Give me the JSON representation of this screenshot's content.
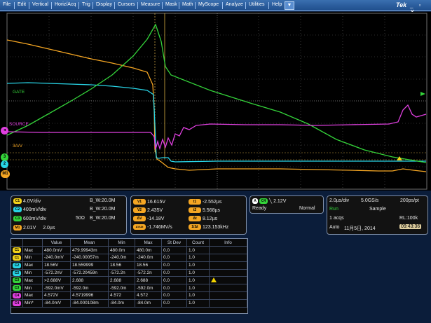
{
  "menu": {
    "items": [
      "File",
      "Edit",
      "Vertical",
      "Horiz/Acq",
      "Trig",
      "Display",
      "Cursors",
      "Measure",
      "Mask",
      "Math",
      "MyScope",
      "Analyze",
      "Utilities",
      "Help"
    ],
    "dropdown_glyph": "▼",
    "brand": "Tek",
    "window_buttons": "_ ▫ ✕"
  },
  "screen": {
    "labels": {
      "gate": "GATE",
      "source": "SOURCE",
      "threshold": "3A/V"
    },
    "markers": {
      "ch1": "1",
      "ch2": "2",
      "ch3": "3",
      "math": "M1"
    },
    "colors": {
      "ch1": "#f2d21a",
      "ch2": "#28d4e6",
      "ch3": "#34d33a",
      "ch4": "#e040e0",
      "math": "#f5a623"
    }
  },
  "channels": [
    {
      "tag": "C1",
      "color": "#f2d21a",
      "scale": "4.0V/div",
      "extra": "",
      "bw": "B_W:20.0M"
    },
    {
      "tag": "C2",
      "color": "#28d4e6",
      "scale": "400mV/div",
      "extra": "",
      "bw": "B_W:20.0M"
    },
    {
      "tag": "C3",
      "color": "#34d33a",
      "scale": "600mV/div",
      "extra": "50Ω",
      "bw": "B_W:20.0M"
    },
    {
      "tag": "M1",
      "color": "#f5a623",
      "scale": "2.01V",
      "extra": "2.0µs",
      "bw": ""
    }
  ],
  "cursors": {
    "v1": {
      "label": "V1",
      "value": "16.615V"
    },
    "t1": {
      "label": "t1",
      "value": "-2.552µs"
    },
    "v2": {
      "label": "V2",
      "value": "2.435V"
    },
    "t2": {
      "label": "t2",
      "value": "5.568µs"
    },
    "dv": {
      "label": "ΔV",
      "value": "-14.18V"
    },
    "dt": {
      "label": "Δt",
      "value": "8.12µs"
    },
    "dvdt": {
      "label": "ΔV/Δt",
      "value": "-1.746MV/s"
    },
    "freq": {
      "label": "1/Δt",
      "value": "123.153kHz"
    }
  },
  "trigger": {
    "source": "A",
    "channel": "C4",
    "level": "2.12V",
    "state": "Ready",
    "mode": "Normal"
  },
  "acquisition": {
    "timebase": "2.0µs/div",
    "rate": "5.0GS/s",
    "resolution": "200ps/pt",
    "run_state": "Run",
    "mode": "Sample",
    "acqs": "1 acqs",
    "record_length": "RL:100k",
    "auto": "Auto",
    "date": "11月5日, 2014",
    "time": "09:43:36"
  },
  "measurements": {
    "headers": [
      "",
      "",
      "Value",
      "Mean",
      "Min",
      "Max",
      "St Dev",
      "Count",
      "Info"
    ],
    "rows": [
      {
        "ch": "C1",
        "color": "#f2d21a",
        "type": "Max",
        "value": "480.0mV",
        "mean": "479.99943m",
        "min": "480.0m",
        "max": "480.0m",
        "stdev": "0.0",
        "count": "1.0",
        "info": ""
      },
      {
        "ch": "C1",
        "color": "#f2d21a",
        "type": "Min",
        "value": "-240.0mV",
        "mean": "-240.00057m",
        "min": "-240.0m",
        "max": "-240.0m",
        "stdev": "0.0",
        "count": "1.0",
        "info": ""
      },
      {
        "ch": "C2",
        "color": "#28d4e6",
        "type": "Max",
        "value": "18.56V",
        "mean": "18.559999",
        "min": "18.56",
        "max": "18.56",
        "stdev": "0.0",
        "count": "1.0",
        "info": ""
      },
      {
        "ch": "C2",
        "color": "#28d4e6",
        "type": "Min",
        "value": "-572.2nV",
        "mean": "-572.20459n",
        "min": "-572.2n",
        "max": "-572.2n",
        "stdev": "0.0",
        "count": "1.0",
        "info": ""
      },
      {
        "ch": "C3",
        "color": "#34d33a",
        "type": "Max",
        "value": ">2.688V",
        "mean": "2.688",
        "min": "2.688",
        "max": "2.688",
        "stdev": "0.0",
        "count": "1.0",
        "info": "warning"
      },
      {
        "ch": "C3",
        "color": "#34d33a",
        "type": "Min",
        "value": "-592.0mV",
        "mean": "-592.0m",
        "min": "-592.0m",
        "max": "-592.0m",
        "stdev": "0.0",
        "count": "1.0",
        "info": ""
      },
      {
        "ch": "C4",
        "color": "#e040e0",
        "type": "Max",
        "value": "4.572V",
        "mean": "4.5719996",
        "min": "4.572",
        "max": "4.572",
        "stdev": "0.0",
        "count": "1.0",
        "info": ""
      },
      {
        "ch": "C4",
        "color": "#e040e0",
        "type": "Min*",
        "value": "-84.0mV",
        "mean": "-84.000108m",
        "min": "-84.0m",
        "max": "-84.0m",
        "stdev": "0.0",
        "count": "1.0",
        "info": ""
      }
    ]
  }
}
